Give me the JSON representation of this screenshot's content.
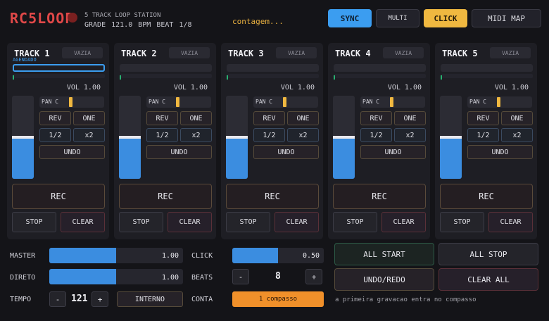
{
  "header": {
    "logo": "RC5LOOP",
    "subtitle": "5 TRACK LOOP STATION",
    "status": "GRADE 121.0 BPM   BEAT 1/8",
    "count_text": "contagem...",
    "buttons": {
      "sync": "SYNC",
      "multi": "MULTI",
      "click": "CLICK",
      "midi": "MIDI MAP"
    }
  },
  "tracks": [
    {
      "title": "TRACK 1",
      "state": "VAZIA",
      "scheduled": "AGENDADO",
      "volume": "VOL 1.00",
      "pan": "PAN C",
      "progress": 0,
      "fader_level": 0.5,
      "rev": "REV",
      "one": "ONE",
      "half": "1/2",
      "double": "x2",
      "undo": "UNDO",
      "rec": "REC",
      "stop": "STOP",
      "clear": "CLEAR"
    },
    {
      "title": "TRACK 2",
      "state": "VAZIA",
      "scheduled": "",
      "volume": "VOL 1.00",
      "pan": "PAN C",
      "progress": 0,
      "fader_level": 0.5,
      "rev": "REV",
      "one": "ONE",
      "half": "1/2",
      "double": "x2",
      "undo": "UNDO",
      "rec": "REC",
      "stop": "STOP",
      "clear": "CLEAR"
    },
    {
      "title": "TRACK 3",
      "state": "VAZIA",
      "scheduled": "",
      "volume": "VOL 1.00",
      "pan": "PAN C",
      "progress": 0,
      "fader_level": 0.5,
      "rev": "REV",
      "one": "ONE",
      "half": "1/2",
      "double": "x2",
      "undo": "UNDO",
      "rec": "REC",
      "stop": "STOP",
      "clear": "CLEAR"
    },
    {
      "title": "TRACK 4",
      "state": "VAZIA",
      "scheduled": "",
      "volume": "VOL 1.00",
      "pan": "PAN C",
      "progress": 0,
      "fader_level": 0.5,
      "rev": "REV",
      "one": "ONE",
      "half": "1/2",
      "double": "x2",
      "undo": "UNDO",
      "rec": "REC",
      "stop": "STOP",
      "clear": "CLEAR"
    },
    {
      "title": "TRACK 5",
      "state": "VAZIA",
      "scheduled": "",
      "volume": "VOL 1.00",
      "pan": "PAN C",
      "progress": 0,
      "fader_level": 0.5,
      "rev": "REV",
      "one": "ONE",
      "half": "1/2",
      "double": "x2",
      "undo": "UNDO",
      "rec": "REC",
      "stop": "STOP",
      "clear": "CLEAR"
    }
  ],
  "mixer": {
    "master": {
      "label": "MASTER",
      "value": "1.00",
      "level": 0.5
    },
    "direto": {
      "label": "DIRETO",
      "value": "1.00",
      "level": 0.5
    },
    "tempo": {
      "label": "TEMPO",
      "minus": "-",
      "value": "121",
      "plus": "+",
      "source": "INTERNO"
    },
    "click": {
      "label": "CLICK",
      "value": "0.50",
      "level": 0.5
    },
    "beats": {
      "label": "BEATS",
      "minus": "-",
      "value": "8",
      "plus": "+"
    },
    "conta": {
      "label": "CONTA",
      "value": "1 compasso"
    }
  },
  "global": {
    "all_start": "ALL START",
    "all_stop": "ALL STOP",
    "undo_redo": "UNDO/REDO",
    "clear_all": "CLEAR ALL",
    "hint": "a primeira gravacao entra no compasso"
  },
  "colors": {
    "accent_blue": "#3b9df0",
    "accent_yellow": "#f0b840",
    "accent_orange": "#f0902a",
    "logo_red": "#e04848",
    "background": "#141418",
    "panel": "#1e1e24"
  }
}
